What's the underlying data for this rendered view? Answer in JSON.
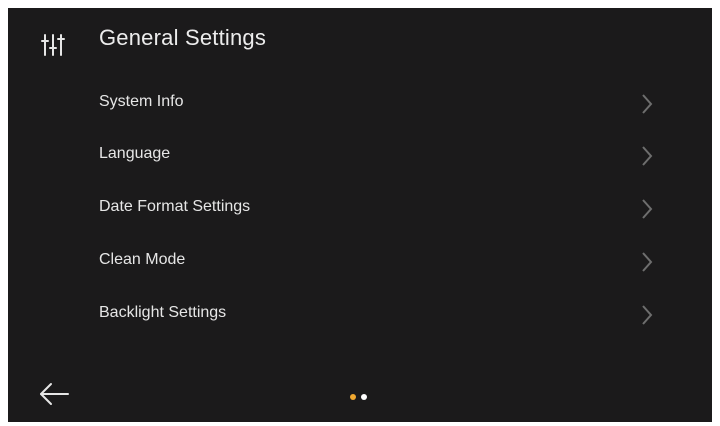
{
  "header": {
    "title": "General Settings",
    "icon": "sliders-icon"
  },
  "menu": {
    "items": [
      {
        "label": "System Info",
        "icon": "chevron-right-icon"
      },
      {
        "label": "Language",
        "icon": "chevron-right-icon"
      },
      {
        "label": "Date Format Settings",
        "icon": "chevron-right-icon"
      },
      {
        "label": "Clean Mode",
        "icon": "chevron-right-icon"
      },
      {
        "label": "Backlight Settings",
        "icon": "chevron-right-icon"
      }
    ]
  },
  "footer": {
    "back_icon": "arrow-left-icon",
    "pager": {
      "total_pages": 2,
      "current_page": 1
    }
  },
  "colors": {
    "background": "#1b1a1b",
    "text": "#e6e6e6",
    "chevron": "#6e6e6e",
    "active_dot": "#f0a830",
    "inactive_dot": "#ffffff"
  }
}
